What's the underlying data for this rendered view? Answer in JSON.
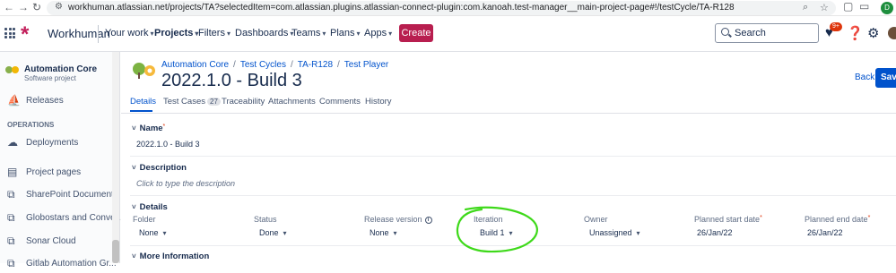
{
  "browser": {
    "url": "workhuman.atlassian.net/projects/TA?selectedItem=com.atlassian.plugins.atlassian-connect-plugin:com.kanoah.test-manager__main-project-page#!/testCycle/TA-R128",
    "profile_initial": "D"
  },
  "topnav": {
    "brand": "Workhuman",
    "menus": [
      "Your work",
      "Projects",
      "Filters",
      "Dashboards",
      "Teams",
      "Plans",
      "Apps"
    ],
    "create_label": "Create",
    "search_placeholder": "Search",
    "notifications_badge": "9+"
  },
  "sidebar": {
    "project_name": "Automation Core",
    "project_type": "Software project",
    "items": [
      {
        "label": "Releases",
        "icon": "ship-icon"
      },
      {
        "label": "Deployments",
        "icon": "cloud-upload-icon"
      },
      {
        "label": "Project pages",
        "icon": "document-icon"
      },
      {
        "label": "SharePoint Documents",
        "icon": "external-link-icon"
      },
      {
        "label": "Globostars and Conve...",
        "icon": "external-link-icon"
      },
      {
        "label": "Sonar Cloud",
        "icon": "external-link-icon"
      },
      {
        "label": "Gitlab Automation Gr...",
        "icon": "external-link-icon"
      }
    ],
    "operations_header": "OPERATIONS"
  },
  "main": {
    "breadcrumb": [
      "Automation Core",
      "Test Cycles",
      "TA-R128",
      "Test Player"
    ],
    "title": "2022.1.0 - Build 3",
    "back_label": "Back",
    "save_label": "Save",
    "tabs": [
      {
        "label": "Details"
      },
      {
        "label": "Test Cases",
        "count": "27"
      },
      {
        "label": "Traceability"
      },
      {
        "label": "Attachments"
      },
      {
        "label": "Comments"
      },
      {
        "label": "History"
      }
    ],
    "name_section": {
      "label": "Name",
      "required_mark": "*",
      "value": "2022.1.0 - Build 3"
    },
    "description_section": {
      "label": "Description",
      "placeholder": "Click to type the description"
    },
    "details_section": {
      "label": "Details",
      "fields": [
        {
          "label": "Folder",
          "value": "None"
        },
        {
          "label": "Status",
          "value": "Done"
        },
        {
          "label": "Release version",
          "value": "None"
        },
        {
          "label": "Iteration",
          "value": "Build 1"
        },
        {
          "label": "Owner",
          "value": "Unassigned"
        },
        {
          "label": "Planned start date",
          "value": "26/Jan/22",
          "required_mark": "*"
        },
        {
          "label": "Planned end date",
          "value": "26/Jan/22",
          "required_mark": "*"
        }
      ]
    },
    "more_info_section": {
      "label": "More Information"
    }
  },
  "colors": {
    "accent": "#0052cc",
    "create": "#b81e4f",
    "annotation": "#3ed91a"
  }
}
